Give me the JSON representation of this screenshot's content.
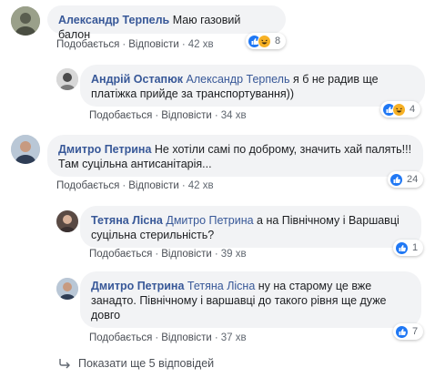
{
  "common": {
    "like_label": "Подобається",
    "reply_label": "Відповісти",
    "separator": "·"
  },
  "comments": [
    {
      "author": "Александр Терпель",
      "mention": "",
      "text": "Маю газовий балон",
      "time": "42 хв",
      "reaction_count": "8",
      "reactions": [
        "like",
        "haha"
      ]
    },
    {
      "author": "Андрій Остапюк",
      "mention": "Александр Терпель",
      "text": "я б не радив ще платіжка прийде за транспортування))",
      "time": "34 хв",
      "reaction_count": "4",
      "reactions": [
        "like",
        "haha"
      ]
    },
    {
      "author": "Дмитро Петрина",
      "mention": "",
      "text": "Не хотіли самі по доброму, значить хай палять!!! Там суцільна антисанітарія...",
      "time": "42 хв",
      "reaction_count": "24",
      "reactions": [
        "like"
      ]
    },
    {
      "author": "Тетяна Лісна",
      "mention": "Дмитро Петрина",
      "text": "а на Північному і Варшавці суцільна стерильність?",
      "time": "39 хв",
      "reaction_count": "1",
      "reactions": [
        "like"
      ]
    },
    {
      "author": "Дмитро Петрина",
      "mention": "Тетяна Лісна",
      "text": "ну на старому це вже занадто. Північному і варшавці до такого рівня ще дуже довго",
      "time": "37 хв",
      "reaction_count": "7",
      "reactions": [
        "like"
      ]
    }
  ],
  "more_replies": "Показати ще 5 відповідей",
  "colors": {
    "link": "#385898",
    "bubble": "#f2f3f5",
    "like": "#2078f4",
    "haha": "#f7b125"
  },
  "icons": [
    "like-icon",
    "haha-icon",
    "reply-arrow-icon"
  ]
}
